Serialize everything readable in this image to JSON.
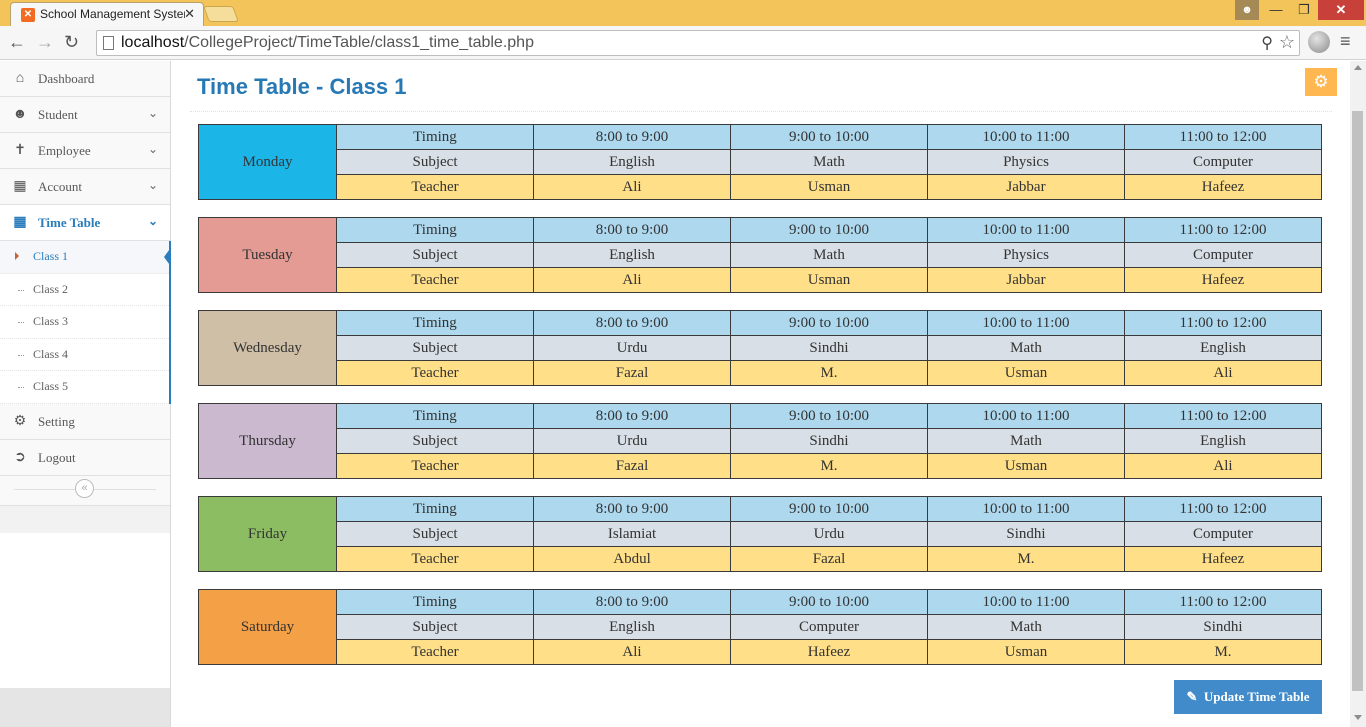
{
  "browser": {
    "tab_title": "School Management System",
    "url_host": "localhost",
    "url_path": "/CollegeProject/TimeTable/class1_time_table.php"
  },
  "sidebar": {
    "items": [
      {
        "label": "Dashboard",
        "icon": "home-icon"
      },
      {
        "label": "Student",
        "icon": "users-icon"
      },
      {
        "label": "Employee",
        "icon": "person-icon"
      },
      {
        "label": "Account",
        "icon": "calculator-icon"
      },
      {
        "label": "Time Table",
        "icon": "calendar-icon"
      },
      {
        "label": "Setting",
        "icon": "gear-icon"
      },
      {
        "label": "Logout",
        "icon": "logout-icon"
      }
    ],
    "submenu": [
      "Class 1",
      "Class 2",
      "Class 3",
      "Class 4",
      "Class 5"
    ]
  },
  "page": {
    "title": "Time Table - Class 1",
    "update_label": "Update Time Table"
  },
  "row_labels": {
    "timing": "Timing",
    "subject": "Subject",
    "teacher": "Teacher"
  },
  "timings": [
    "8:00 to 9:00",
    "9:00 to 10:00",
    "10:00 to 11:00",
    "11:00 to 12:00"
  ],
  "days": [
    {
      "name": "Monday",
      "color": "#1bb5e8",
      "subjects": [
        "English",
        "Math",
        "Physics",
        "Computer"
      ],
      "teachers": [
        "Ali",
        "Usman",
        "Jabbar",
        "Hafeez"
      ]
    },
    {
      "name": "Tuesday",
      "color": "#e39b94",
      "subjects": [
        "English",
        "Math",
        "Physics",
        "Computer"
      ],
      "teachers": [
        "Ali",
        "Usman",
        "Jabbar",
        "Hafeez"
      ]
    },
    {
      "name": "Wednesday",
      "color": "#cfbfa6",
      "subjects": [
        "Urdu",
        "Sindhi",
        "Math",
        "English"
      ],
      "teachers": [
        "Fazal",
        "M.",
        "Usman",
        "Ali"
      ]
    },
    {
      "name": "Thursday",
      "color": "#cbb9cf",
      "subjects": [
        "Urdu",
        "Sindhi",
        "Math",
        "English"
      ],
      "teachers": [
        "Fazal",
        "M.",
        "Usman",
        "Ali"
      ]
    },
    {
      "name": "Friday",
      "color": "#8cbd62",
      "subjects": [
        "Islamiat",
        "Urdu",
        "Sindhi",
        "Computer"
      ],
      "teachers": [
        "Abdul",
        "Fazal",
        "M.",
        "Hafeez"
      ]
    },
    {
      "name": "Saturday",
      "color": "#f4a046",
      "subjects": [
        "English",
        "Computer",
        "Math",
        "Sindhi"
      ],
      "teachers": [
        "Ali",
        "Hafeez",
        "Usman",
        "M."
      ]
    }
  ]
}
